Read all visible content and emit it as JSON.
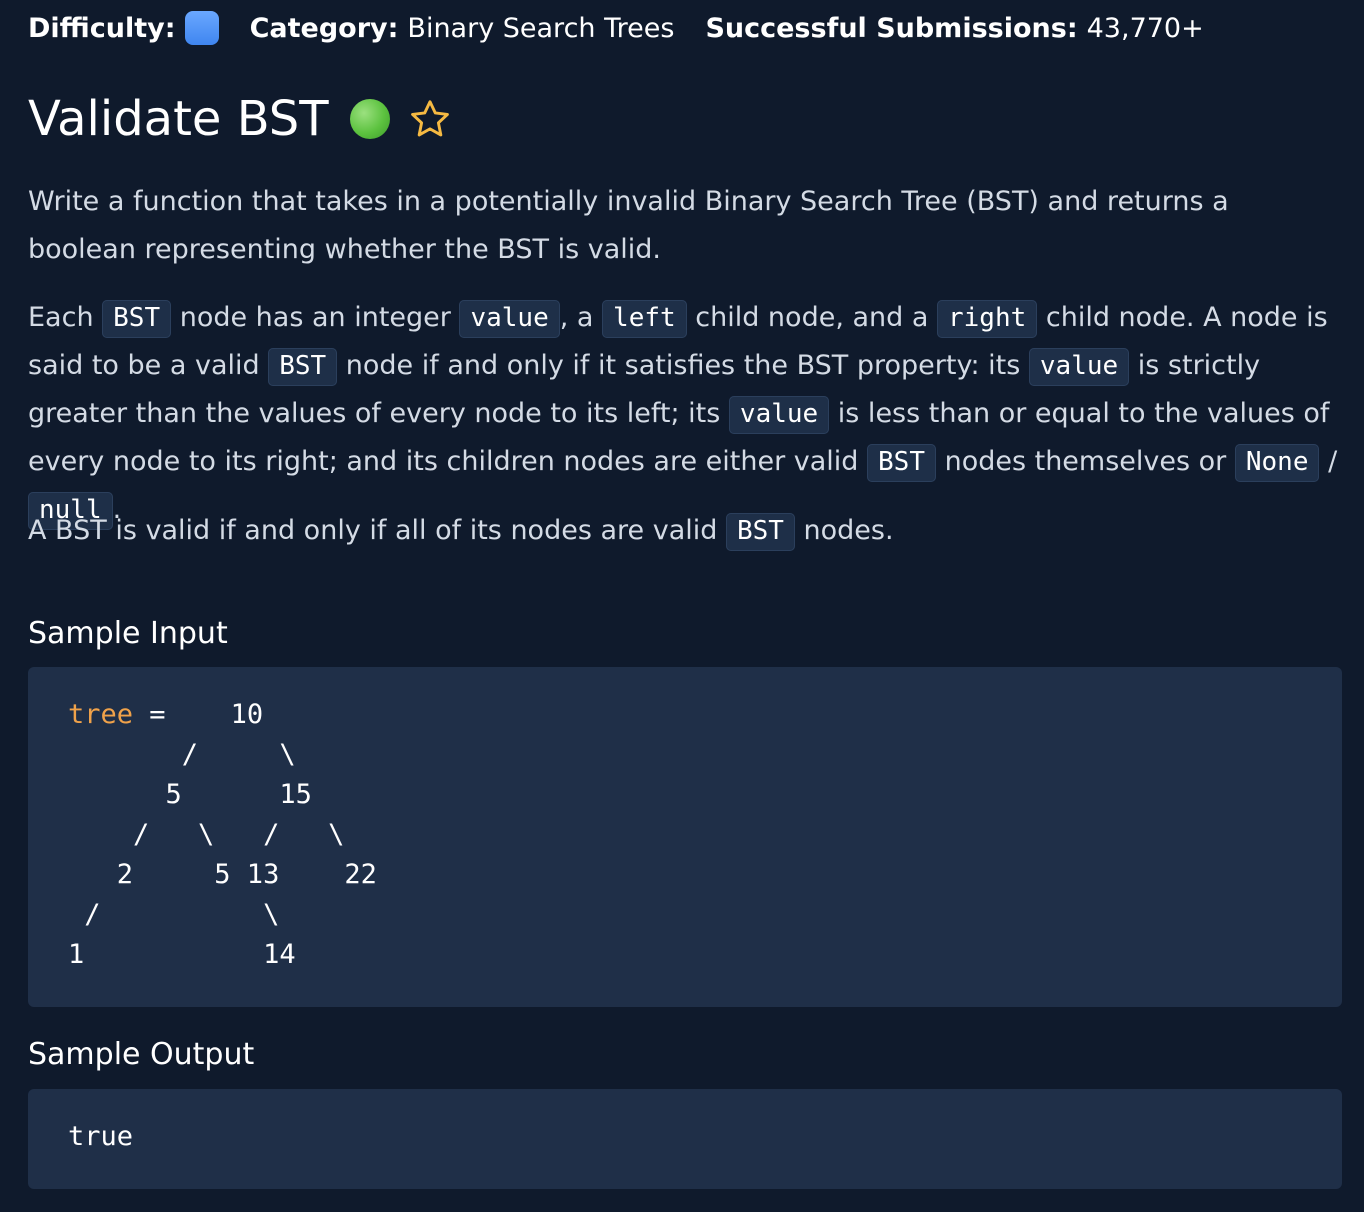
{
  "meta": {
    "difficulty_label": "Difficulty:",
    "category_label": "Category:",
    "category_value": "Binary Search Trees",
    "submissions_label": "Successful Submissions:",
    "submissions_value": "43,770+"
  },
  "title": "Validate BST",
  "icons": {
    "difficulty": "blue-square-icon",
    "completed": "green-dot-icon",
    "favorite": "star-outline-icon"
  },
  "colors": {
    "background": "#0f1a2c",
    "code_bg": "#1f2f48",
    "difficulty": "#4a90f5",
    "completed": "#5cc23f",
    "star": "#f5b942",
    "variable": "#f0a24a"
  },
  "description": {
    "p1": "Write a function that takes in a potentially invalid Binary Search Tree (BST) and returns a boolean representing whether the BST is valid.",
    "p2": {
      "t1": "Each ",
      "c1": "BST",
      "t2": " node has an integer ",
      "c2": "value",
      "t3": ", a ",
      "c3": "left",
      "t4": " child node, and a ",
      "c4": "right",
      "t5": " child node. A node is said to be a valid ",
      "c5": "BST",
      "t6": " node if and only if it satisfies the BST property: its ",
      "c6": "value",
      "t7": " is strictly greater than the values of every node to its left; its ",
      "c7": "value",
      "t8": " is less than or equal to the values of every node to its right; and its children nodes are either valid ",
      "c8": "BST",
      "t9": " nodes themselves or ",
      "c9": "None",
      "t10": " / ",
      "c10": "null",
      "t11": "."
    },
    "p3": {
      "t1": "A BST is valid if and only if all of its nodes are valid ",
      "c1": "BST",
      "t2": " nodes."
    }
  },
  "sample_input": {
    "heading": "Sample Input",
    "var_name": "tree",
    "line1_rest": " =    10",
    "lines": "       /     \\\n      5      15\n    /   \\   /   \\\n   2     5 13    22\n /          \\\n1           14"
  },
  "sample_output": {
    "heading": "Sample Output",
    "value": "true"
  }
}
